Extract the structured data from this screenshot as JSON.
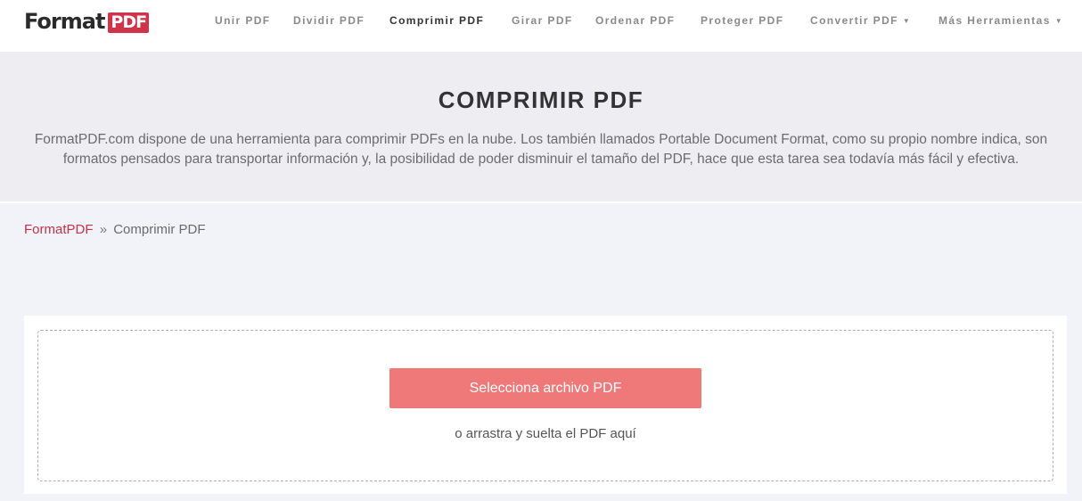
{
  "header": {
    "logo_word": "Format",
    "logo_badge": "PDF",
    "nav": [
      {
        "label": "Unir PDF",
        "active": false
      },
      {
        "label": "Dividir PDF",
        "active": false
      },
      {
        "label": "Comprimir PDF",
        "active": true
      },
      {
        "label": "Girar PDF",
        "active": false
      },
      {
        "label": "Ordenar PDF",
        "active": false
      },
      {
        "label": "Proteger PDF",
        "active": false
      },
      {
        "label": "Convertir PDF",
        "active": false,
        "dropdown": true
      },
      {
        "label": "Más Herramientas",
        "active": false,
        "dropdown": true
      }
    ],
    "caret_glyph": "▼"
  },
  "hero": {
    "title": "COMPRIMIR PDF",
    "description_line1": "FormatPDF.com dispone de una herramienta para comprimir PDFs en la nube. Los también llamados Portable Document Format, como su propio nombre indica, son",
    "description_line2": "formatos pensados para transportar información y, la posibilidad de poder disminuir el tamaño del PDF, hace que esta tarea sea todavía más fácil y efectiva."
  },
  "breadcrumb": {
    "home": "FormatPDF",
    "separator": "»",
    "current": "Comprimir PDF"
  },
  "upload": {
    "button_label": "Selecciona archivo PDF",
    "drop_hint": "o arrastra y suelta el PDF aquí"
  },
  "colors": {
    "brand_red": "#d1334a",
    "button": "#ef7878",
    "page_bg": "#f1f3f9",
    "hero_bg": "#eeeef2"
  }
}
